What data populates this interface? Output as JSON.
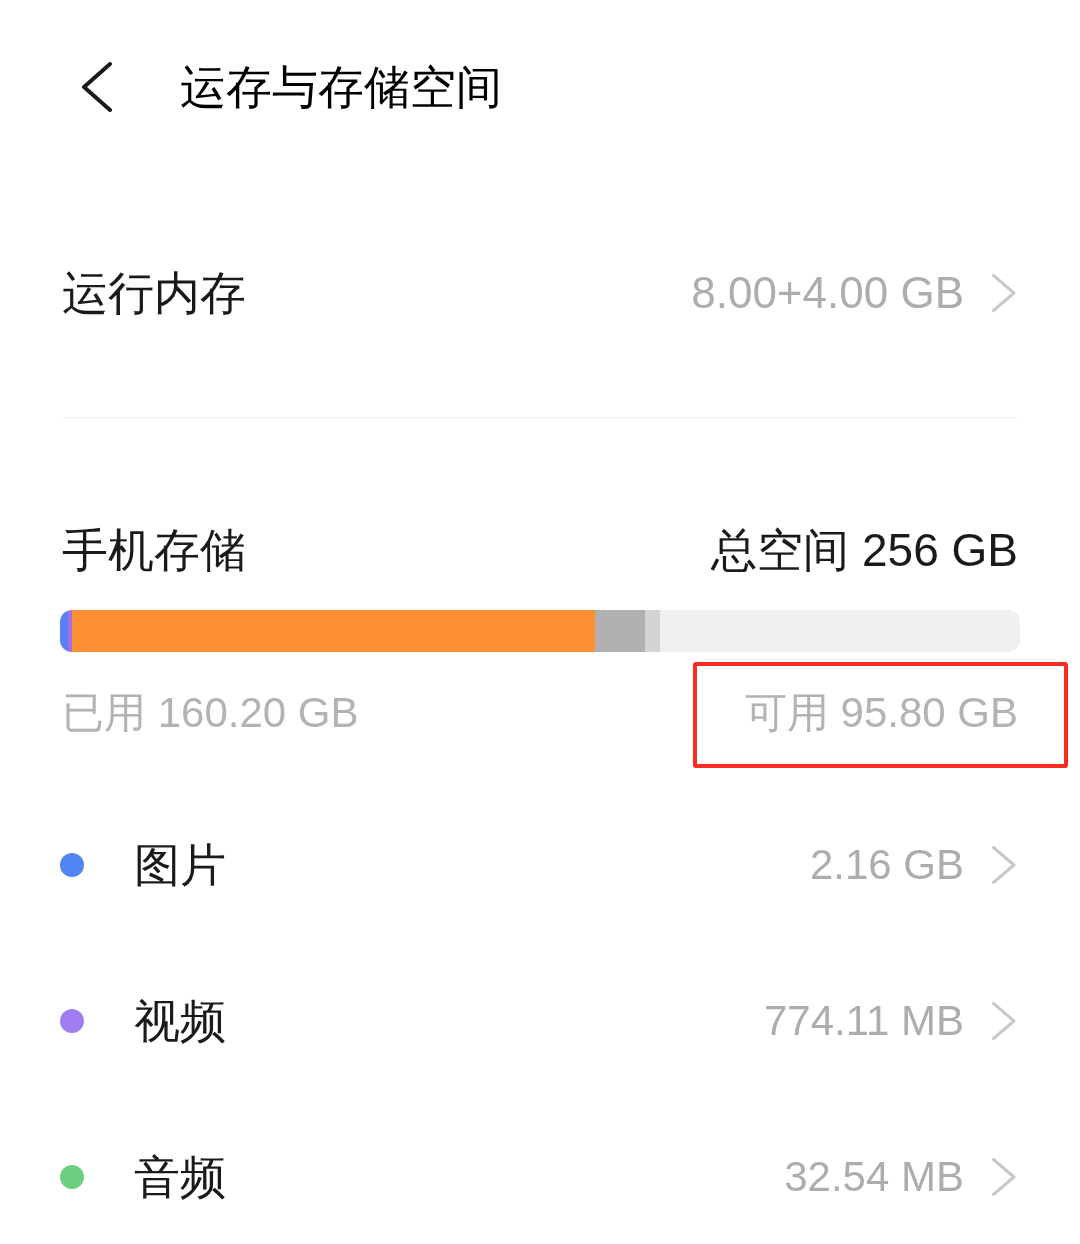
{
  "header": {
    "title": "运存与存储空间"
  },
  "ram": {
    "label": "运行内存",
    "value": "8.00+4.00 GB"
  },
  "storage": {
    "label": "手机存储",
    "total": "总空间 256 GB",
    "bar": {
      "level": 0.625
    },
    "used": "已用 160.20 GB",
    "available": {
      "text": "可用 95.80 GB",
      "highlighted": true
    }
  },
  "categories": [
    {
      "label": "图片",
      "value": "2.16 GB",
      "color": "#5284f4"
    },
    {
      "label": "视频",
      "value": "774.11 MB",
      "color": "#a07df2"
    },
    {
      "label": "音频",
      "value": "32.54 MB",
      "color": "#6dcf7f"
    }
  ]
}
